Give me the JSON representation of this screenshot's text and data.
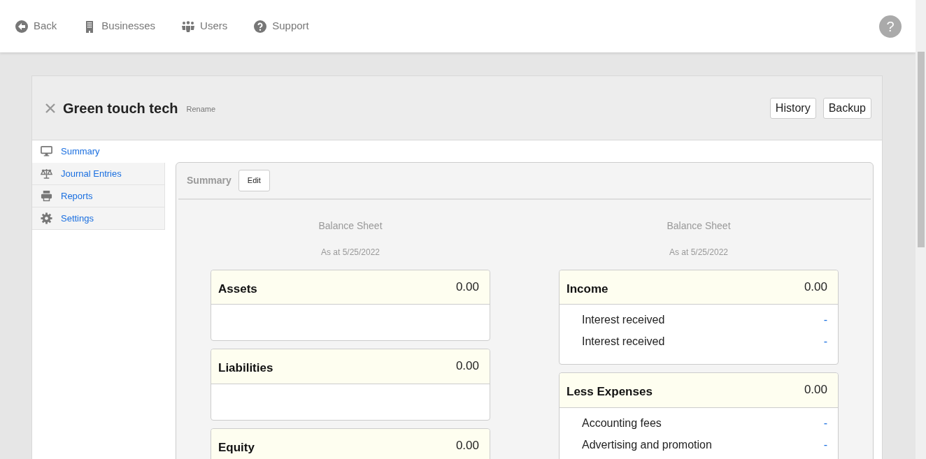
{
  "nav": {
    "items": [
      {
        "label": "Back"
      },
      {
        "label": "Businesses"
      },
      {
        "label": "Users"
      },
      {
        "label": "Support"
      }
    ],
    "help": "?"
  },
  "business": {
    "name": "Green touch tech",
    "rename": "Rename",
    "actions": [
      "History",
      "Backup"
    ]
  },
  "sidebar": {
    "items": [
      {
        "label": "Summary",
        "selected": true
      },
      {
        "label": "Journal Entries",
        "selected": false
      },
      {
        "label": "Reports",
        "selected": false
      },
      {
        "label": "Settings",
        "selected": false
      }
    ]
  },
  "summary": {
    "title": "Summary",
    "edit": "Edit",
    "columns": [
      {
        "title": "Balance Sheet",
        "date": "As at 5/25/2022",
        "sections": [
          {
            "name": "Assets",
            "total": "0.00"
          },
          {
            "name": "Liabilities",
            "total": "0.00"
          },
          {
            "name": "Equity",
            "total": "0.00"
          }
        ]
      },
      {
        "title": "Balance Sheet",
        "date": "As at 5/25/2022",
        "sections": [
          {
            "name": "Income",
            "total": "0.00",
            "rows": [
              {
                "label": "Interest received",
                "value": "-"
              },
              {
                "label": "Interest received",
                "value": "-"
              }
            ]
          },
          {
            "name": "Less Expenses",
            "total": "0.00",
            "rows": [
              {
                "label": "Accounting fees",
                "value": "-"
              },
              {
                "label": "Advertising and promotion",
                "value": "-"
              }
            ]
          }
        ]
      }
    ]
  }
}
